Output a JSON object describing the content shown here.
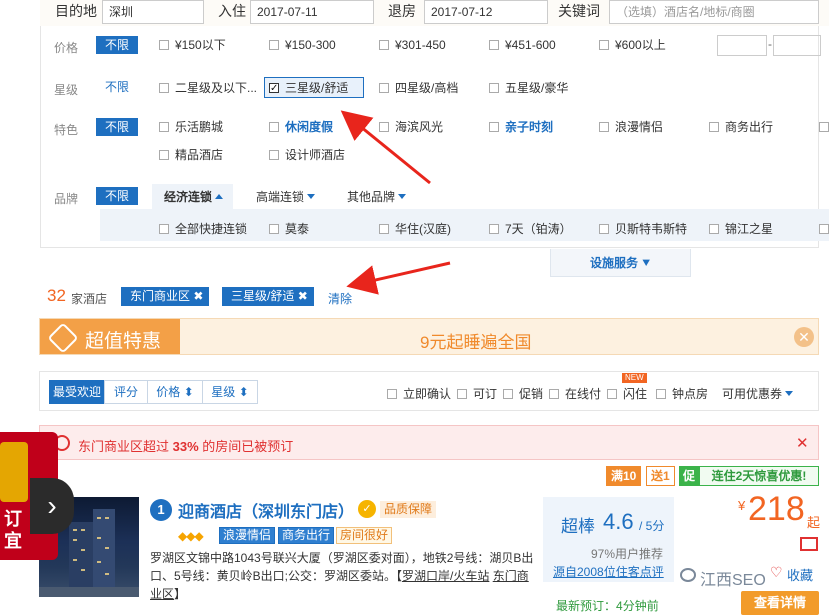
{
  "search": {
    "dest_label": "目的地",
    "dest_value": "深圳",
    "checkin_label": "入住",
    "checkin_value": "2017-07-11",
    "checkout_label": "退房",
    "checkout_value": "2017-07-12",
    "keyword_label": "关键词",
    "keyword_placeholder": "（选填）酒店名/地标/商圈"
  },
  "filters": {
    "price": {
      "label": "价格",
      "all": "不限",
      "options": [
        "¥150以下",
        "¥150-300",
        "¥301-450",
        "¥451-600",
        "¥600以上"
      ],
      "range_sep": "-"
    },
    "star": {
      "label": "星级",
      "all": "不限",
      "options": [
        "二星级及以下...",
        "三星级/舒适",
        "四星级/高档",
        "五星级/豪华"
      ],
      "selected": "三星级/舒适"
    },
    "feature": {
      "label": "特色",
      "all": "不限",
      "options": [
        "乐活鹏城",
        "休闲度假",
        "海滨风光",
        "亲子时刻",
        "浪漫情侣",
        "商务出行",
        "精品酒店",
        "设计师酒店"
      ]
    },
    "brand": {
      "label": "品牌",
      "all": "不限",
      "groups": [
        "经济连锁",
        "高端连锁",
        "其他品牌"
      ],
      "options": [
        "全部快捷连锁",
        "莫泰",
        "华住(汉庭)",
        "7天（铂涛）",
        "贝斯特韦斯特",
        "锦江之星"
      ]
    },
    "facility_toggle": "设施服务"
  },
  "results": {
    "count": "32",
    "count_label": "家酒店",
    "tags": [
      "东门商业区",
      "三星级/舒适"
    ],
    "clear": "清除"
  },
  "promo": {
    "title": "超值特惠",
    "text": "9元起睡遍全国"
  },
  "sort": {
    "buttons": [
      "最受欢迎",
      "评分",
      "价格",
      "星级"
    ],
    "options": [
      "立即确认",
      "可订",
      "促销",
      "在线付",
      "闪住",
      "钟点房"
    ],
    "new_badge": "NEW",
    "coupon": "可用优惠券"
  },
  "alert": {
    "pre": "东门商业区超过 ",
    "pct": "33%",
    "post": " 的房间已被预订"
  },
  "hotel": {
    "badges": {
      "man": "满10",
      "song": "送1",
      "cu": "促",
      "cu_text": "连住2天惊喜优惠!"
    },
    "index": "1",
    "name": "迎商酒店（深圳东门店）",
    "guarantee": "品质保障",
    "diamonds": "◆◆◆",
    "tags": [
      "浪漫情侣",
      "商务出行",
      "房间很好"
    ],
    "address_1": "罗湖区文锦中路1043号联兴大厦（罗湖区委对面），地铁2号线：湖贝B出口、5号线：黄贝岭B出口;公交：罗湖区委站。【",
    "address_link": "罗湖口岸/火车站",
    "address_2": "东门商业区",
    "address_end": "】",
    "score_word": "超棒",
    "score": "4.6",
    "score_den": "/ 5分",
    "recommend": "97%用户推荐",
    "source": "源自2008位住客点评",
    "latest_label": "最新预订：",
    "latest_time": "4分钟前",
    "price_currency": "¥",
    "price": "218",
    "price_suffix": "起",
    "collect": "收藏",
    "detail": "查看详情"
  },
  "side_ad": {
    "text_1": "订",
    "text_2": "宜"
  },
  "watermark": "江西SEO",
  "colors": {
    "brand_blue": "#1e6fc0",
    "accent_orange": "#f26522",
    "alert_red": "#e03131"
  }
}
